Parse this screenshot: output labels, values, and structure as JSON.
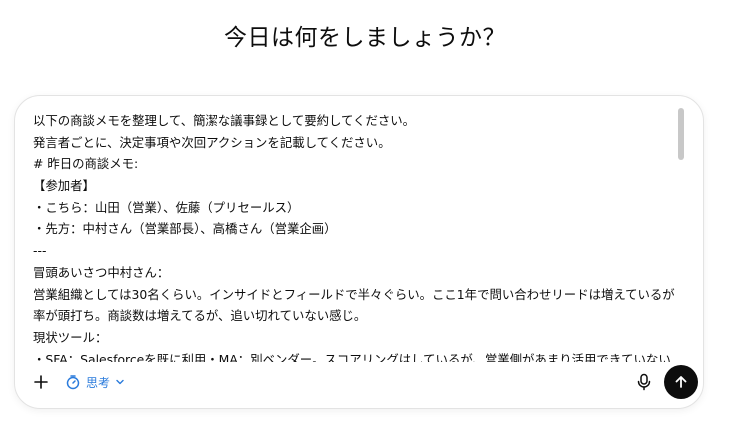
{
  "heading": "今日は何をしましょうか？",
  "composer": {
    "lines": [
      "以下の商談メモを整理して、簡潔な議事録として要約してください。",
      " 発言者ごとに、決定事項や次回アクションを記載してください。",
      " # 昨日の商談メモ:",
      "【参加者】",
      "・こちら：山田（営業）、佐藤（プリセールス）",
      "・先方：中村さん（営業部長）、高橋さん（営業企画）",
      "---",
      "冒頭あいさつ中村さん：",
      "営業組織としては30名くらい。インサイドとフィールドで半々ぐらい。ここ1年で問い合わせリードは増えているが、受注",
      "率が頭打ち。商談数は増えてるが、追い切れていない感じ。",
      "現状ツール：",
      "・SFA：Salesforceを既に利用・MA：別ベンダー。スコアリングはしているが、営業側があまり活用できていない・メー"
    ]
  },
  "toolbar": {
    "add_icon": "plus-icon",
    "think_label": "思考",
    "think_icon": "timer-icon",
    "mic_icon": "microphone-icon",
    "send_icon": "arrow-up-icon"
  },
  "colors": {
    "accent": "#2a7bdc",
    "send_bg": "#0d0d0d"
  }
}
